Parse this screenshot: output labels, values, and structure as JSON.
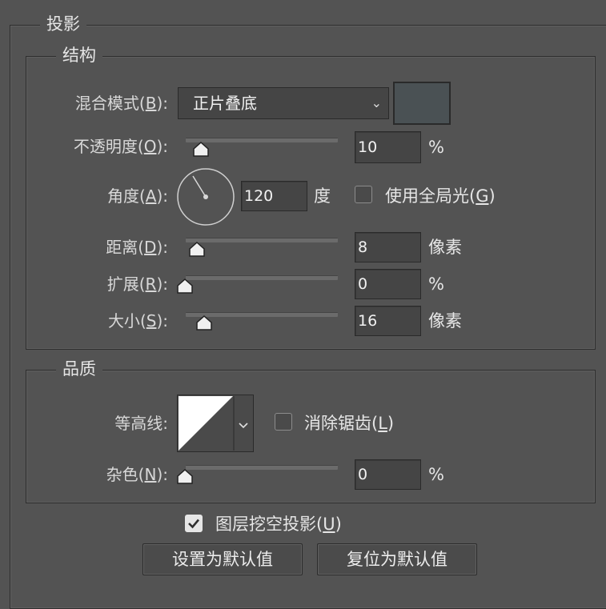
{
  "sections": {
    "drop_shadow": "投影",
    "structure": "结构",
    "quality": "品质"
  },
  "structure": {
    "blend_mode": {
      "label": "混合模式",
      "mnemonic": "B",
      "value": "正片叠底",
      "color": "#4a5154"
    },
    "opacity": {
      "label": "不透明度",
      "mnemonic": "O",
      "value": "10",
      "unit": "%",
      "level": 0.1
    },
    "angle": {
      "label": "角度",
      "mnemonic": "A",
      "value": "120",
      "unit": "度",
      "degrees": 120,
      "global_light_label": "使用全局光",
      "global_light_mnemonic": "G",
      "global_light_checked": false
    },
    "distance": {
      "label": "距离",
      "mnemonic": "D",
      "value": "8",
      "unit": "像素",
      "level": 0.08
    },
    "spread": {
      "label": "扩展",
      "mnemonic": "R",
      "value": "0",
      "unit": "%",
      "level": 0
    },
    "size": {
      "label": "大小",
      "mnemonic": "S",
      "value": "16",
      "unit": "像素",
      "level": 0.13
    }
  },
  "quality": {
    "contour_label": "等高线:",
    "anti_alias_label": "消除锯齿",
    "anti_alias_mnemonic": "L",
    "anti_alias_checked": false,
    "noise": {
      "label": "杂色",
      "mnemonic": "N",
      "value": "0",
      "unit": "%",
      "level": 0
    }
  },
  "knockout": {
    "label": "图层挖空投影",
    "mnemonic": "U",
    "checked": true
  },
  "buttons": {
    "make_default": "设置为默认值",
    "reset_default": "复位为默认值"
  }
}
